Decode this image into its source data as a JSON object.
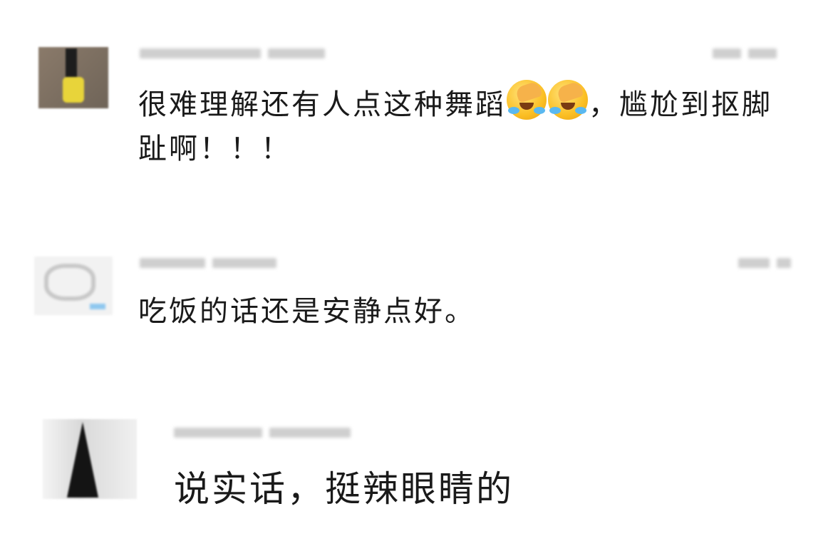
{
  "comments": [
    {
      "text_parts": [
        "很难理解还有人点这种舞蹈",
        "，尴尬到抠脚趾啊！！！"
      ],
      "emoji_names": [
        "face-palm-crying-icon",
        "face-palm-crying-icon"
      ]
    },
    {
      "text": "吃饭的话还是安静点好。"
    },
    {
      "text": "说实话，挺辣眼睛的"
    }
  ],
  "colors": {
    "text": "#1a1a1a",
    "blur_meta": "#cfcfcf",
    "emoji_face": "#fbbf24",
    "tear": "#5ab8f0"
  }
}
